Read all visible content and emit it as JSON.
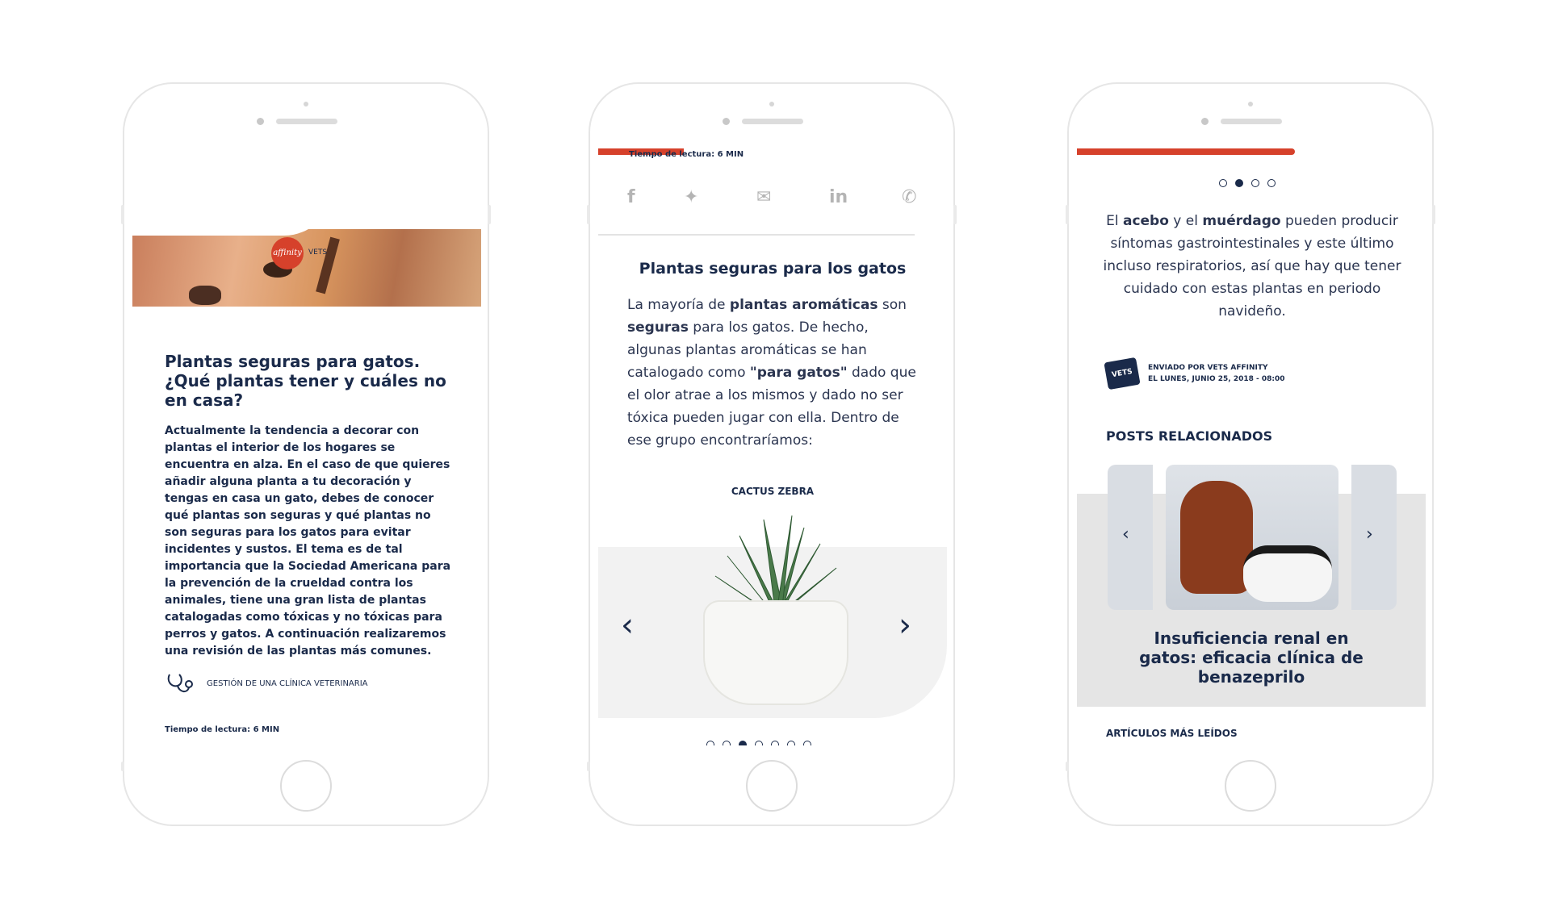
{
  "phone1": {
    "logo_text": "affinity",
    "logo_suffix": "VETS",
    "title": "Plantas seguras para gatos. ¿Qué plantas tener y cuáles no en casa?",
    "lead": "Actualmente la tendencia a decorar con plantas el interior de los hogares se encuentra en alza. En el caso de que quieres añadir alguna planta a tu decoración y tengas en casa un gato, debes de conocer qué plantas son seguras y qué plantas no son seguras para los gatos para evitar incidentes y sustos. El tema es de tal importancia que la Sociedad Americana para la prevención de la crueldad contra los animales, tiene una gran lista de plantas catalogadas como tóxicas y no tóxicas para perros y gatos. A continuación realizaremos una revisión de las plantas más comunes.",
    "category": "GESTIÓN DE UNA CLÍNICA VETERINARIA",
    "reading_time": "Tiempo de lectura: 6 MIN"
  },
  "share_icons": [
    "facebook-icon",
    "twitter-icon",
    "mail-icon",
    "linkedin-icon",
    "whatsapp-icon"
  ],
  "phone2": {
    "reading_time": "Tiempo de lectura: 6 MIN",
    "heading": "Plantas seguras para los gatos",
    "body_parts": {
      "p1": "La mayoría de ",
      "b1": "plantas aromáticas",
      "p2": " son ",
      "b2": "seguras",
      "p3": " para los gatos. De hecho, algunas plantas aromáticas se han catalogado como ",
      "b3": "\"para gatos\"",
      "p4": " dado que el olor atrae a los mismos y dado no ser tóxica pueden jugar con ella. Dentro de ese grupo encontraríamos:"
    },
    "slide_caption": "CACTUS ZEBRA",
    "slide_count": 7,
    "active_slide": 3
  },
  "phone3": {
    "slide_count": 4,
    "active_slide": 2,
    "body_parts": {
      "p1": "El ",
      "b1": "acebo",
      "p2": " y el ",
      "b2": "muérdago",
      "p3": " pueden producir síntomas gastrointestinales y este último incluso respiratorios, así que hay que tener cuidado con estas plantas en periodo navideño."
    },
    "badge": "VETS",
    "sender_line1": "ENVIADO POR VETS AFFINITY",
    "sender_line2": "EL LUNES, JUNIO 25, 2018 - 08:00",
    "related_heading": "POSTS RELACIONADOS",
    "related_title": "Insuficiencia renal en gatos: eficacia clínica de benazeprilo",
    "most_read_heading": "ARTÍCULOS MÁS LEÍDOS"
  },
  "colors": {
    "accent": "#d6412b",
    "navy": "#1a2a4a",
    "gray_band": "#e5e5e5"
  }
}
